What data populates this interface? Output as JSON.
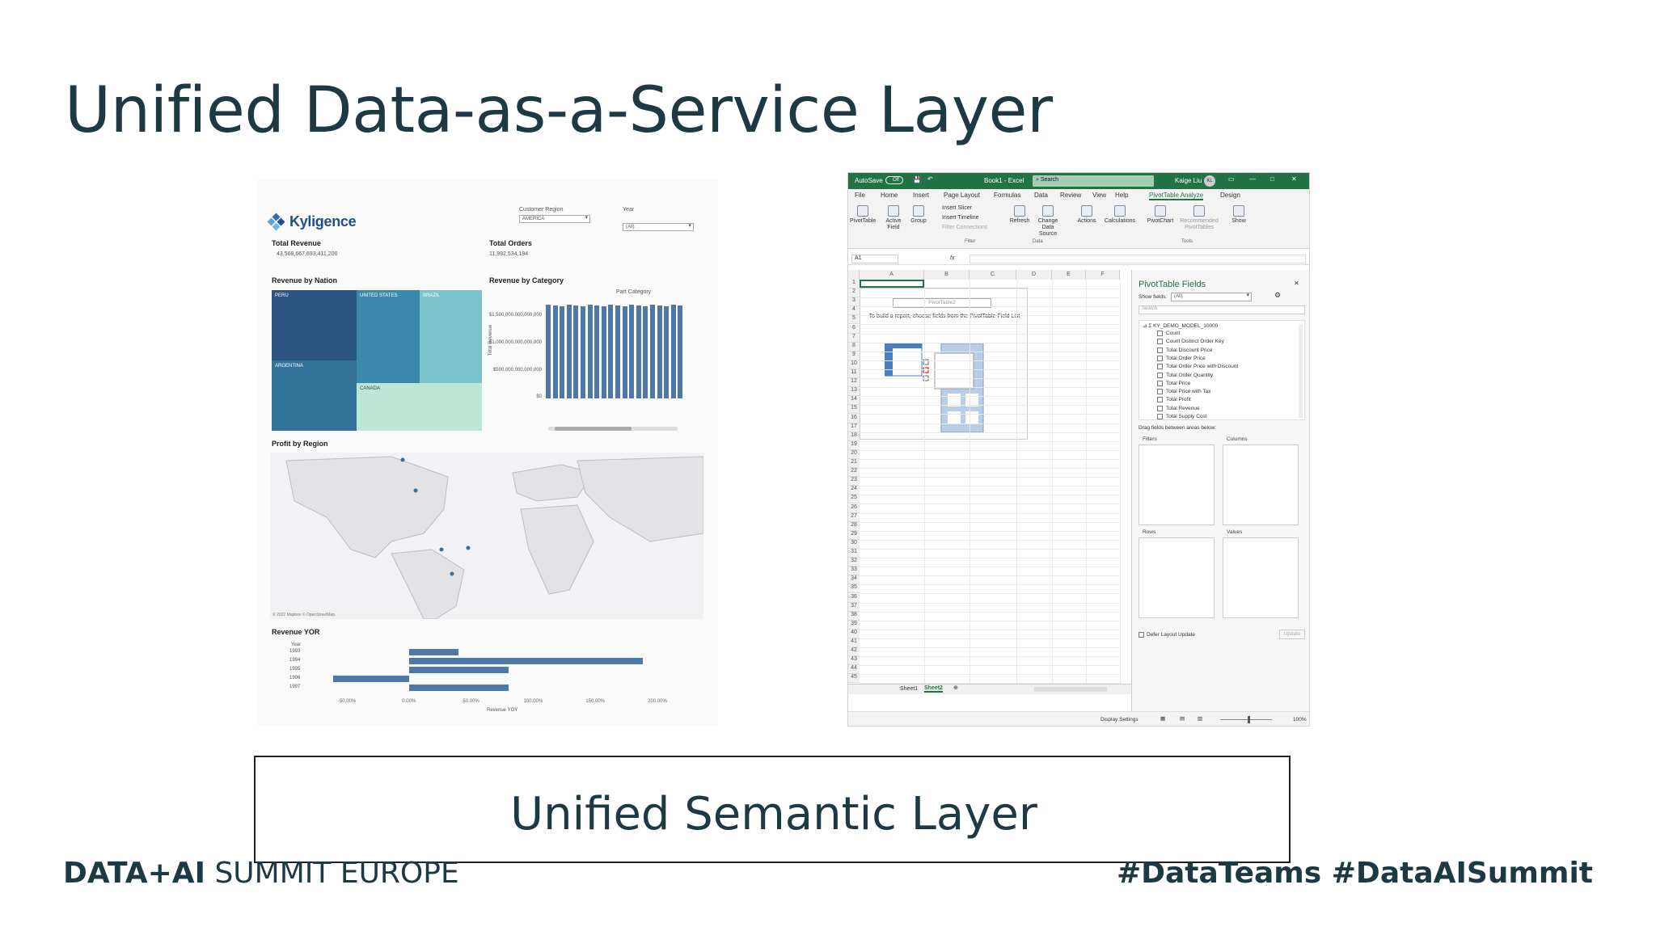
{
  "slide": {
    "title": "Unified Data-as-a-Service Layer",
    "semantic_layer": "Unified Semantic Layer",
    "footer_brand_bold": "DATA+AI",
    "footer_brand_rest": "SUMMIT EUROPE",
    "footer_tags": "#DataTeams #DataAISummit"
  },
  "dashboard": {
    "logo": "Kyligence",
    "filters": {
      "region_label": "Customer Region",
      "region_value": "AMERICA",
      "year_label": "Year",
      "year_value": "(All)"
    },
    "total_revenue_label": "Total Revenue",
    "total_revenue_value": "43,568,667,693,411,200",
    "total_orders_label": "Total Orders",
    "total_orders_value": "11,992,534,194",
    "revenue_by_nation": {
      "title": "Revenue by Nation",
      "tiles": [
        "PERU",
        "UNITED STATES",
        "BRAZIL",
        "ARGENTINA",
        "CANADA"
      ]
    },
    "revenue_by_category": {
      "title": "Revenue by Category",
      "header": "Part Category",
      "ylabel": "Total Revenue",
      "ticks": [
        "$1,500,000,000,000,000",
        "$1,000,000,000,000,000",
        "$500,000,000,000,000",
        "$0"
      ]
    },
    "profit_by_region": {
      "title": "Profit by Region",
      "attribution": "© 2022 Mapbox © OpenStreetMap"
    },
    "revenue_yoy": {
      "title": "Revenue YOR",
      "year_header": "Year",
      "xlabel": "Revenue YOY",
      "xticks": [
        "-50.00%",
        "0.00%",
        "50.00%",
        "100.00%",
        "150.00%",
        "200.00%"
      ]
    }
  },
  "chart_data": [
    {
      "type": "bar",
      "title": "Revenue YOR",
      "xlabel": "Revenue YOY",
      "categories": [
        "1993",
        "1994",
        "1995",
        "1996",
        "1997"
      ],
      "values": [
        40,
        188,
        80,
        -61,
        80
      ],
      "xlim": [
        -65,
        215
      ]
    }
  ],
  "excel": {
    "autosave": "AutoSave",
    "autosave_state": "Off",
    "book": "Book1 - Excel",
    "search": "Search",
    "user": "Kaige Liu",
    "user_initials": "KL",
    "tabs": [
      "File",
      "Home",
      "Insert",
      "Page Layout",
      "Formulas",
      "Data",
      "Review",
      "View",
      "Help",
      "PivotTable Analyze",
      "Design"
    ],
    "ribbon": {
      "pivottable": "PivotTable",
      "active_field": "Active Field",
      "group": "Group",
      "insert_slicer": "Insert Slicer",
      "insert_timeline": "Insert Timeline",
      "filter_connections": "Filter Connections",
      "filter_group": "Filter",
      "refresh": "Refresh",
      "change_source": "Change Data Source",
      "data_group": "Data",
      "actions": "Actions",
      "calculations": "Calculations",
      "pivotchart": "PivotChart",
      "recommended": "Recommended PivotTables",
      "tools_group": "Tools",
      "show": "Show"
    },
    "name_box": "A1",
    "fx": "fx",
    "columns": [
      "A",
      "B",
      "C",
      "D",
      "E",
      "F"
    ],
    "pivot_name": "PivotTable2",
    "pivot_hint": "To build a report, choose fields from the PivotTable Field List",
    "sheets": [
      "Sheet1",
      "Sheet2"
    ],
    "status": {
      "display_settings": "Display Settings",
      "zoom": "100%"
    },
    "pane": {
      "title": "PivotTable Fields",
      "show_fields_label": "Show fields:",
      "show_fields_value": "(All)",
      "search_placeholder": "Search",
      "model": "KY_DEMO_MODEL_10000",
      "fields": [
        "Count",
        "Count Distinct Order Key",
        "Total Discount Price",
        "Total Order Price",
        "Total Order Price with Discount",
        "Total Order Quantity",
        "Total Price",
        "Total Price with Tax",
        "Total Profit",
        "Total Revenue",
        "Total Supply Cost"
      ],
      "drag_hint": "Drag fields between areas below:",
      "areas": [
        "Filters",
        "Columns",
        "Rows",
        "Values"
      ],
      "defer": "Defer Layout Update",
      "update": "Update"
    }
  }
}
